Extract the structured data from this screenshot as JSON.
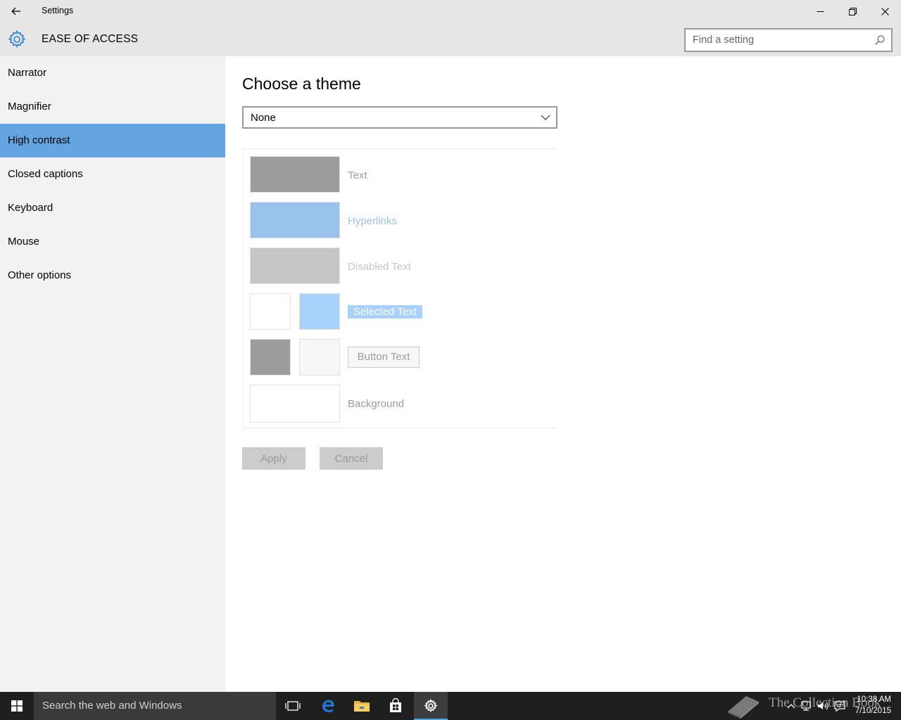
{
  "window": {
    "title": "Settings"
  },
  "header": {
    "section_title": "EASE OF ACCESS",
    "search_placeholder": "Find a setting"
  },
  "sidebar": {
    "items": [
      {
        "label": "Narrator",
        "active": false
      },
      {
        "label": "Magnifier",
        "active": false
      },
      {
        "label": "High contrast",
        "active": true
      },
      {
        "label": "Closed captions",
        "active": false
      },
      {
        "label": "Keyboard",
        "active": false
      },
      {
        "label": "Mouse",
        "active": false
      },
      {
        "label": "Other options",
        "active": false
      }
    ]
  },
  "main": {
    "page_title": "Choose a theme",
    "theme_select": {
      "selected": "None"
    },
    "preview": {
      "text_label": "Text",
      "hyperlinks_label": "Hyperlinks",
      "disabled_label": "Disabled Text",
      "selected_label": "Selected Text",
      "button_label": "Button Text",
      "background_label": "Background"
    },
    "apply_label": "Apply",
    "cancel_label": "Cancel"
  },
  "colors": {
    "accent": "#62a5e1",
    "text_swatch": "#9c9c9c",
    "hyperlink_swatch": "#99c2ea",
    "disabled_swatch": "#c6c6c6",
    "selected_bg_swatch": "#a8d1fb",
    "button_face_swatch": "#f7f7f7"
  },
  "taskbar": {
    "search_text": "Search the web and Windows",
    "watermark": "The Collection Book",
    "time": "10:38 AM",
    "date": "7/10/2015"
  }
}
